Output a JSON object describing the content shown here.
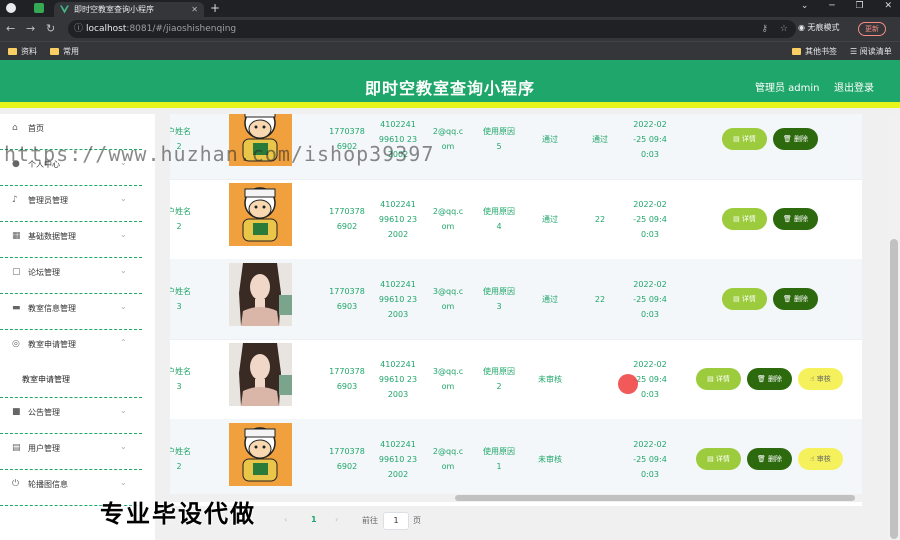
{
  "browser": {
    "tab_title": "即时空教室查询小程序",
    "url_host": "localhost",
    "url_rest": ":8081/#/jiaoshishenqing",
    "incognito_label": "无痕模式",
    "update_label": "更新",
    "bookmarks": [
      "资料",
      "常用"
    ],
    "bookmarks_right": [
      "其他书签",
      "阅读清单"
    ]
  },
  "header": {
    "title": "即时空教室查询小程序",
    "user": "管理员 admin",
    "logout": "退出登录"
  },
  "sidebar": {
    "items": [
      {
        "icon": "home-icon",
        "label": "首页",
        "expandable": false
      },
      {
        "icon": "user-icon",
        "label": "个人中心",
        "expandable": true
      },
      {
        "icon": "mic-icon",
        "label": "管理员管理",
        "expandable": true
      },
      {
        "icon": "database-icon",
        "label": "基础数据管理",
        "expandable": true
      },
      {
        "icon": "forum-icon",
        "label": "论坛管理",
        "expandable": true
      },
      {
        "icon": "classroom-icon",
        "label": "教室信息管理",
        "expandable": true
      },
      {
        "icon": "apply-icon",
        "label": "教室申请管理",
        "expandable": true,
        "open": true
      },
      {
        "icon": "notice-icon",
        "label": "公告管理",
        "expandable": true
      },
      {
        "icon": "users-icon",
        "label": "用户管理",
        "expandable": true
      },
      {
        "icon": "carousel-icon",
        "label": "轮播图信息",
        "expandable": true
      }
    ],
    "subitem": "教室申请管理"
  },
  "table": {
    "rows": [
      {
        "name": "户姓名\n2",
        "avatar": "cartoon",
        "phone": "1770378\n6902",
        "idcard": "4102241\n99610 23\n2002",
        "email": "2@qq.c\nom",
        "reason": "使用原因\n5",
        "status": "通过",
        "reply": "通过",
        "time": "2022-02\n-25 09:4\n0:03",
        "actions": [
          "详情",
          "删除"
        ]
      },
      {
        "name": "户姓名\n2",
        "avatar": "cartoon",
        "phone": "1770378\n6902",
        "idcard": "4102241\n99610 23\n2002",
        "email": "2@qq.c\nom",
        "reason": "使用原因\n4",
        "status": "通过",
        "reply": "22",
        "time": "2022-02\n-25 09:4\n0:03",
        "actions": [
          "详情",
          "删除"
        ]
      },
      {
        "name": "户姓名\n3",
        "avatar": "woman",
        "phone": "1770378\n6903",
        "idcard": "4102241\n99610 23\n2003",
        "email": "3@qq.c\nom",
        "reason": "使用原因\n3",
        "status": "通过",
        "reply": "22",
        "time": "2022-02\n-25 09:4\n0:03",
        "actions": [
          "详情",
          "删除"
        ]
      },
      {
        "name": "户姓名\n3",
        "avatar": "woman",
        "phone": "1770378\n6903",
        "idcard": "4102241\n99610 23\n2003",
        "email": "3@qq.c\nom",
        "reason": "使用原因\n2",
        "status": "未审核",
        "reply": "",
        "time": "2022-02\n-25 09:4\n0:03",
        "actions": [
          "详情",
          "删除",
          "审核"
        ]
      },
      {
        "name": "户姓名\n2",
        "avatar": "cartoon",
        "phone": "1770378\n6902",
        "idcard": "4102241\n99610 23\n2002",
        "email": "2@qq.c\nom",
        "reason": "使用原因\n1",
        "status": "未审核",
        "reply": "",
        "time": "2022-02\n-25 09:4\n0:03",
        "actions": [
          "详情",
          "删除",
          "审核"
        ]
      }
    ]
  },
  "pager": {
    "current": "1",
    "goto_label": "前往",
    "goto_value": "1",
    "page_suffix": "页"
  },
  "overlay": {
    "watermark": "https://www.huzhan.com/ishop39397",
    "promo": "专业毕设代做"
  },
  "colors": {
    "primary": "#1fa66a",
    "accent_bar": "#e6f51c",
    "detail_btn": "#9ccc3d",
    "delete_btn": "#2d6a0e",
    "audit_btn": "#f5f15c"
  }
}
